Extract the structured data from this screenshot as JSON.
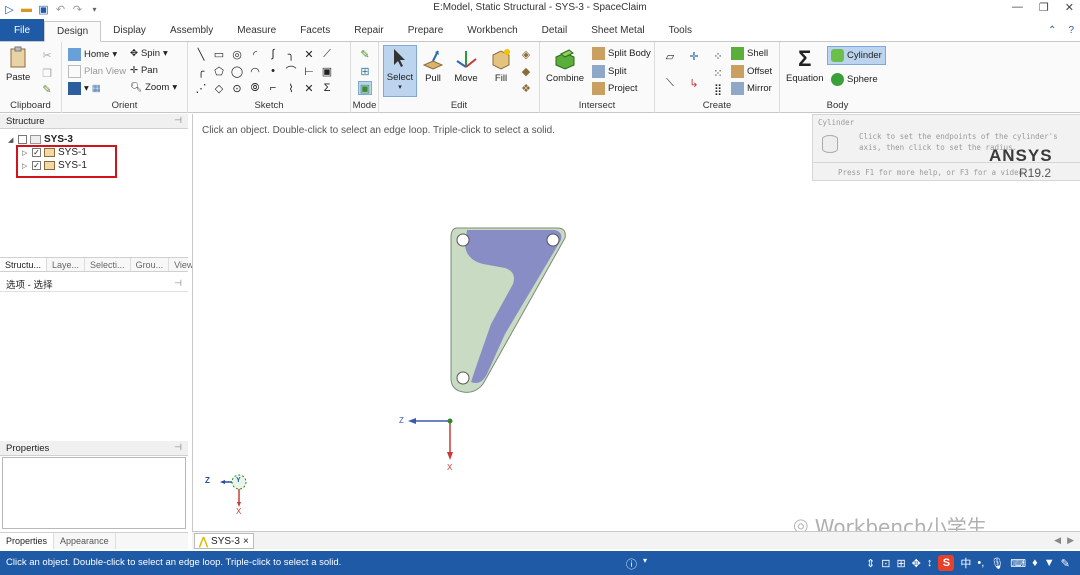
{
  "window": {
    "title": "E:Model, Static Structural - SYS-3 - SpaceClaim",
    "controls": [
      "—",
      "❐",
      "✕"
    ]
  },
  "tabs": {
    "file": "File",
    "items": [
      "Design",
      "Display",
      "Assembly",
      "Measure",
      "Facets",
      "Repair",
      "Prepare",
      "Workbench",
      "Detail",
      "Sheet Metal",
      "Tools"
    ],
    "active": "Design"
  },
  "ribbon": {
    "clipboard": {
      "label": "Clipboard",
      "paste": "Paste"
    },
    "orient": {
      "label": "Orient",
      "home": "Home",
      "spin": "Spin",
      "plan_view": "Plan View",
      "pan": "Pan",
      "zoom": "Zoom"
    },
    "sketch": {
      "label": "Sketch"
    },
    "mode": {
      "label": "Mode"
    },
    "edit": {
      "label": "Edit",
      "select": "Select",
      "pull": "Pull",
      "move": "Move",
      "fill": "Fill"
    },
    "intersect": {
      "label": "Intersect",
      "combine": "Combine",
      "split_body": "Split Body",
      "split": "Split",
      "project": "Project"
    },
    "create": {
      "label": "Create",
      "shell": "Shell",
      "offset": "Offset",
      "mirror": "Mirror"
    },
    "body": {
      "label": "Body",
      "equation": "Equation",
      "cylinder": "Cylinder",
      "sphere": "Sphere"
    }
  },
  "structure": {
    "title": "Structure",
    "root": "SYS-3",
    "children": [
      "SYS-1",
      "SYS-1"
    ],
    "subtabs": [
      "Structu...",
      "Laye...",
      "Selecti...",
      "Grou...",
      "Views"
    ]
  },
  "options": {
    "title": "选项 - 选择"
  },
  "properties": {
    "title": "Properties",
    "tabs": [
      "Properties",
      "Appearance"
    ]
  },
  "viewport": {
    "hint": "Click an object. Double-click to select an edge loop. Triple-click to select a solid.",
    "tooltip": {
      "title": "Cylinder",
      "body": "Click to set the endpoints of the cylinder's axis, then click to set the radius.",
      "foot": "Press F1 for more help, or F3 for a video."
    },
    "brand": "ANSYS",
    "version": "R19.2",
    "axis_main": {
      "z": "Z",
      "x": "X"
    },
    "axis_mini": {
      "z": "Z",
      "y": "Y",
      "x": "X"
    },
    "watermark": "Workbench小学生"
  },
  "doc_tab": {
    "label": "SYS-3",
    "close": "×"
  },
  "status": {
    "text": "Click an object. Double-click to select an edge loop. Triple-click to select a solid.",
    "ime": "中"
  },
  "colors": {
    "accent": "#1f5aa6",
    "highlight_box": "#d0141a",
    "body_fill": "#c9dcc3",
    "mesh_fill": "#7e7fc7"
  }
}
